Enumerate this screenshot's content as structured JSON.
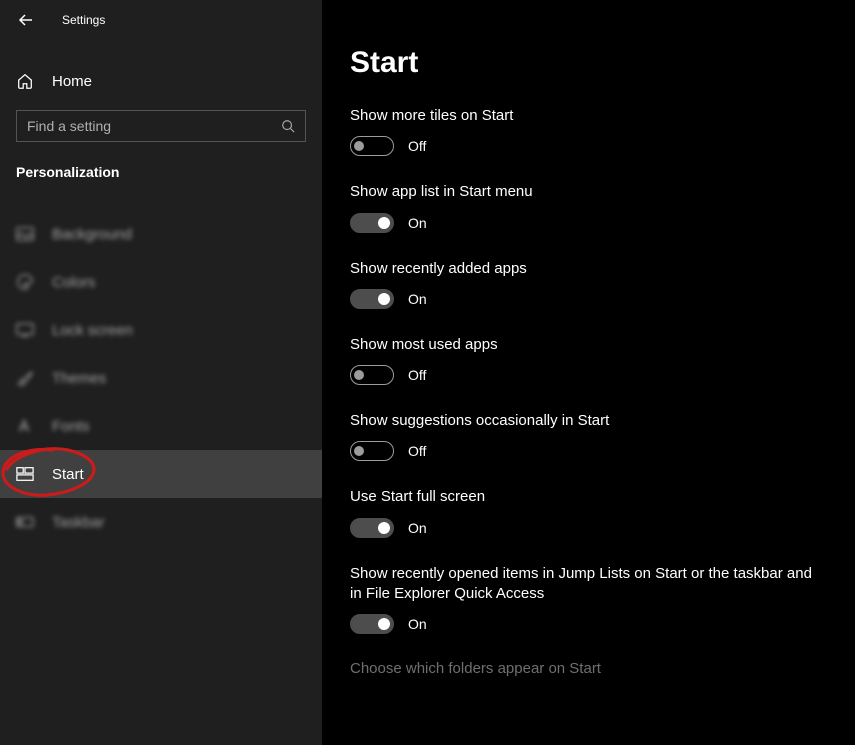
{
  "window": {
    "title": "Settings"
  },
  "sidebar": {
    "home_label": "Home",
    "search_placeholder": "Find a setting",
    "category": "Personalization",
    "items": [
      {
        "label": "Background",
        "selected": false
      },
      {
        "label": "Colors",
        "selected": false
      },
      {
        "label": "Lock screen",
        "selected": false
      },
      {
        "label": "Themes",
        "selected": false
      },
      {
        "label": "Fonts",
        "selected": false
      },
      {
        "label": "Start",
        "selected": true
      },
      {
        "label": "Taskbar",
        "selected": false
      }
    ]
  },
  "page": {
    "title": "Start",
    "toggles": [
      {
        "label": "Show more tiles on Start",
        "on": false,
        "state": "Off"
      },
      {
        "label": "Show app list in Start menu",
        "on": true,
        "state": "On"
      },
      {
        "label": "Show recently added apps",
        "on": true,
        "state": "On"
      },
      {
        "label": "Show most used apps",
        "on": false,
        "state": "Off"
      },
      {
        "label": "Show suggestions occasionally in Start",
        "on": false,
        "state": "Off"
      },
      {
        "label": "Use Start full screen",
        "on": true,
        "state": "On"
      },
      {
        "label": "Show recently opened items in Jump Lists on Start or the taskbar and in File Explorer Quick Access",
        "on": true,
        "state": "On"
      }
    ],
    "link": "Choose which folders appear on Start"
  },
  "annotation": {
    "color": "#cc1b1b"
  }
}
